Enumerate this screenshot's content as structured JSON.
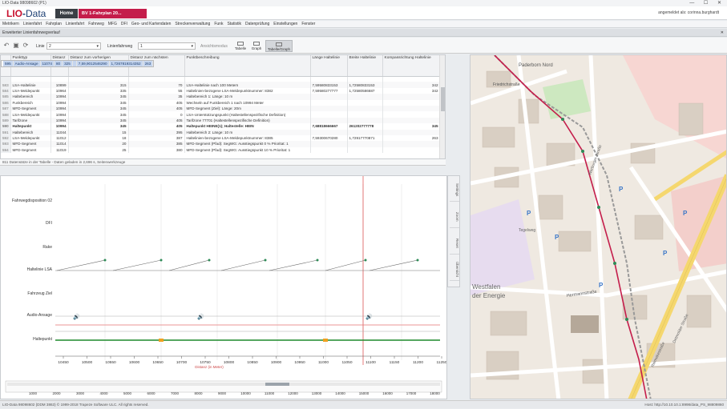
{
  "window": {
    "title": "LIO-Data 98098602 (P1)",
    "controls": "—  ☐  ✕"
  },
  "app": {
    "logo_main": "LIO",
    "logo_sep": "-",
    "logo_rest": "Data",
    "tab_home": "Home",
    "tab_doc": "BV 1-Fahrplan 20...",
    "user": "angemeldet als: corinna.burghardt"
  },
  "menu": [
    "Metrikern",
    "Linienfahrt",
    "Fahrplan",
    "Linienfahrt",
    "Fahrweg",
    "MFG",
    "DFI",
    "Geo- und Kartendaten",
    "Streckenverwaltung",
    "Funk",
    "Statistik",
    "Datenprüfung",
    "Einstellungen",
    "Fenster"
  ],
  "section": {
    "title": "Erweiterter Linienfahrwegverlauf",
    "close": "✕"
  },
  "toolbar": {
    "linie_label": "Linie",
    "linie_value": "2",
    "fahrweg_label": "Linienfahrweg",
    "fahrweg_value": "1",
    "ansicht_label": "Ansichtsmodus",
    "views": [
      "Tabelle",
      "Graph",
      "Tabelle/Graph"
    ]
  },
  "table": {
    "headers": [
      "",
      "Punkttyp",
      "Distanz",
      "Distanz zum vorherigen Haltepunkt",
      "Distanz zum nächsten Haltepunkt",
      "Punktbeschreibung",
      "Länge Haltelinie",
      "Breite Haltelinie",
      "Kompassrichtung Haltelinie"
    ],
    "rows": [
      {
        "rn": "",
        "typ": "",
        "dist": "",
        "prev": "",
        "next": "",
        "desc": "",
        "lang": "",
        "breit": "",
        "komp": "",
        "style": ""
      },
      {
        "rn": "583",
        "typ": "LSA-Haltelinie",
        "dist": "10899",
        "prev": "315",
        "next": "70",
        "desc": "LSA-Haltelinie nach 100 Metern",
        "lang": "7,59580833153",
        "breit": "1,72580833153",
        "komp": "342",
        "style": ""
      },
      {
        "rn": "584",
        "typ": "LSA-Meldepunkt",
        "dist": "10964",
        "prev": "335",
        "next": "55",
        "desc": "Haltelinien-bezogene LSA-Meldepunktnummer: 8382",
        "lang": "7,59580277777",
        "breit": "1,72580586687",
        "komp": "342",
        "style": ""
      },
      {
        "rn": "585",
        "typ": "Haltebereich",
        "dist": "10994",
        "prev": "345",
        "next": "35",
        "desc": "Haltebereich 1: Länge: 10 m",
        "lang": "",
        "breit": "",
        "komp": "",
        "style": ""
      },
      {
        "rn": "586",
        "typ": "Funkbereich",
        "dist": "10994",
        "prev": "345",
        "next": "405",
        "desc": "Wechseln auf Funkbereich 1 nach 10994 Meter",
        "lang": "",
        "breit": "",
        "komp": "",
        "style": ""
      },
      {
        "rn": "587",
        "typ": "MFD-Segment",
        "dist": "10994",
        "prev": "345",
        "next": "405",
        "desc": "MFD-Segment (Ziel): Länge: 20m",
        "lang": "",
        "breit": "",
        "komp": "",
        "style": ""
      },
      {
        "rn": "588",
        "typ": "LSA-Meldepunkt",
        "dist": "10994",
        "prev": "345",
        "next": "0",
        "desc": "LSA-Unterstützungspunkt (Haltestellenspezifische Definition)",
        "lang": "",
        "breit": "",
        "komp": "",
        "style": ""
      },
      {
        "rn": "589",
        "typ": "Tarifzone",
        "dist": "10994",
        "prev": "345",
        "next": "405",
        "desc": "Tarifzone 77701 (Haltestellenspezifische Definition)",
        "lang": "",
        "breit": "",
        "komp": "",
        "style": ""
      },
      {
        "rn": "590",
        "typ": "Haltepunkt",
        "dist": "10994",
        "prev": "345",
        "next": "405",
        "desc": "Haltepunkt HEINE(1); Haltestelle: HEIN",
        "lang": "7,68818666667",
        "breit": "261202777778",
        "komp": "345",
        "style": "bold"
      },
      {
        "rn": "591",
        "typ": "Haltebereich",
        "dist": "11044",
        "prev": "15",
        "next": "395",
        "desc": "Haltebereich 2: Länge: 10 m",
        "lang": "",
        "breit": "",
        "komp": "",
        "style": ""
      },
      {
        "rn": "592",
        "typ": "LSA-Meldepunkt",
        "dist": "11012",
        "prev": "18",
        "next": "387",
        "desc": "Haltelinien-bezogene LSA-Meldepunktnummer: 8385",
        "lang": "7,59300670280",
        "breit": "1,72917770871",
        "komp": "263",
        "style": ""
      },
      {
        "rn": "593",
        "typ": "MFD-Segment",
        "dist": "11014",
        "prev": "20",
        "next": "385",
        "desc": "MFD-Segment (Pfad): SegWG: Ausstiegspunkt 0 % Prioritat: 1",
        "lang": "",
        "breit": "",
        "komp": "",
        "style": ""
      },
      {
        "rn": "594",
        "typ": "MFD-Segment",
        "dist": "11019",
        "prev": "25",
        "next": "380",
        "desc": "MFD-Segment (Pfad): SegWG: Ausstiegspunkt 10 % Prioritat: 1",
        "lang": "",
        "breit": "",
        "komp": "",
        "style": ""
      },
      {
        "rn": "595",
        "typ": "Audio-Ansage",
        "dist": "11074",
        "prev": "80",
        "next": "325",
        "desc": "",
        "lang": "7,59,9012546290",
        "breit": "1,7267819314352",
        "komp": "263",
        "style": "sel"
      }
    ]
  },
  "status_line": "811 Datensätze in der Tabelle - Daten geladen in 2,696 s, Seitenwerkzeuge",
  "graph": {
    "y_labels": [
      "Fahrwegdisposition 02",
      "DFI",
      "Rake",
      "Haltelinie LSA",
      "Fahrzeug Ziel",
      "Audio-Ansage",
      "Haltepunkt"
    ],
    "x_ticks": [
      "10450",
      "10500",
      "10550",
      "10600",
      "10650",
      "10700",
      "10750",
      "10800",
      "10850",
      "10900",
      "10950",
      "11000",
      "11050",
      "11100",
      "11150",
      "11200",
      "11250"
    ],
    "overview_ticks": [
      "1000",
      "2000",
      "3000",
      "4000",
      "5000",
      "6000",
      "7000",
      "8000",
      "9000",
      "10000",
      "11000",
      "12000",
      "13000",
      "14000",
      "15000",
      "16000",
      "17000",
      "18000"
    ],
    "distance_label": "Distanz (in Meter)",
    "side_tools": [
      "Settings",
      "Zoom",
      "Reset",
      "Übersicht"
    ]
  },
  "map": {
    "labels": [
      "Paderborn Nord",
      "Friedrichstraße",
      "Warburger Straße",
      "Hermannstraße",
      "Westfalen",
      "der Energie",
      "Riemekestraße",
      "Detmolder Straße",
      "Tegelweg"
    ],
    "colors": {
      "rail": "#c41d4b",
      "road_major": "#f5d76e",
      "park": "#cde8c0",
      "building": "#d9cfc3"
    }
  },
  "footer": {
    "left": "LIO-Data 98098602 (DDM 3863) © 1999-2018 Trapeze Software ULC. All rights reserved.",
    "right": "Host: http://10.10.10.1:8998/data_PS_98809860"
  }
}
